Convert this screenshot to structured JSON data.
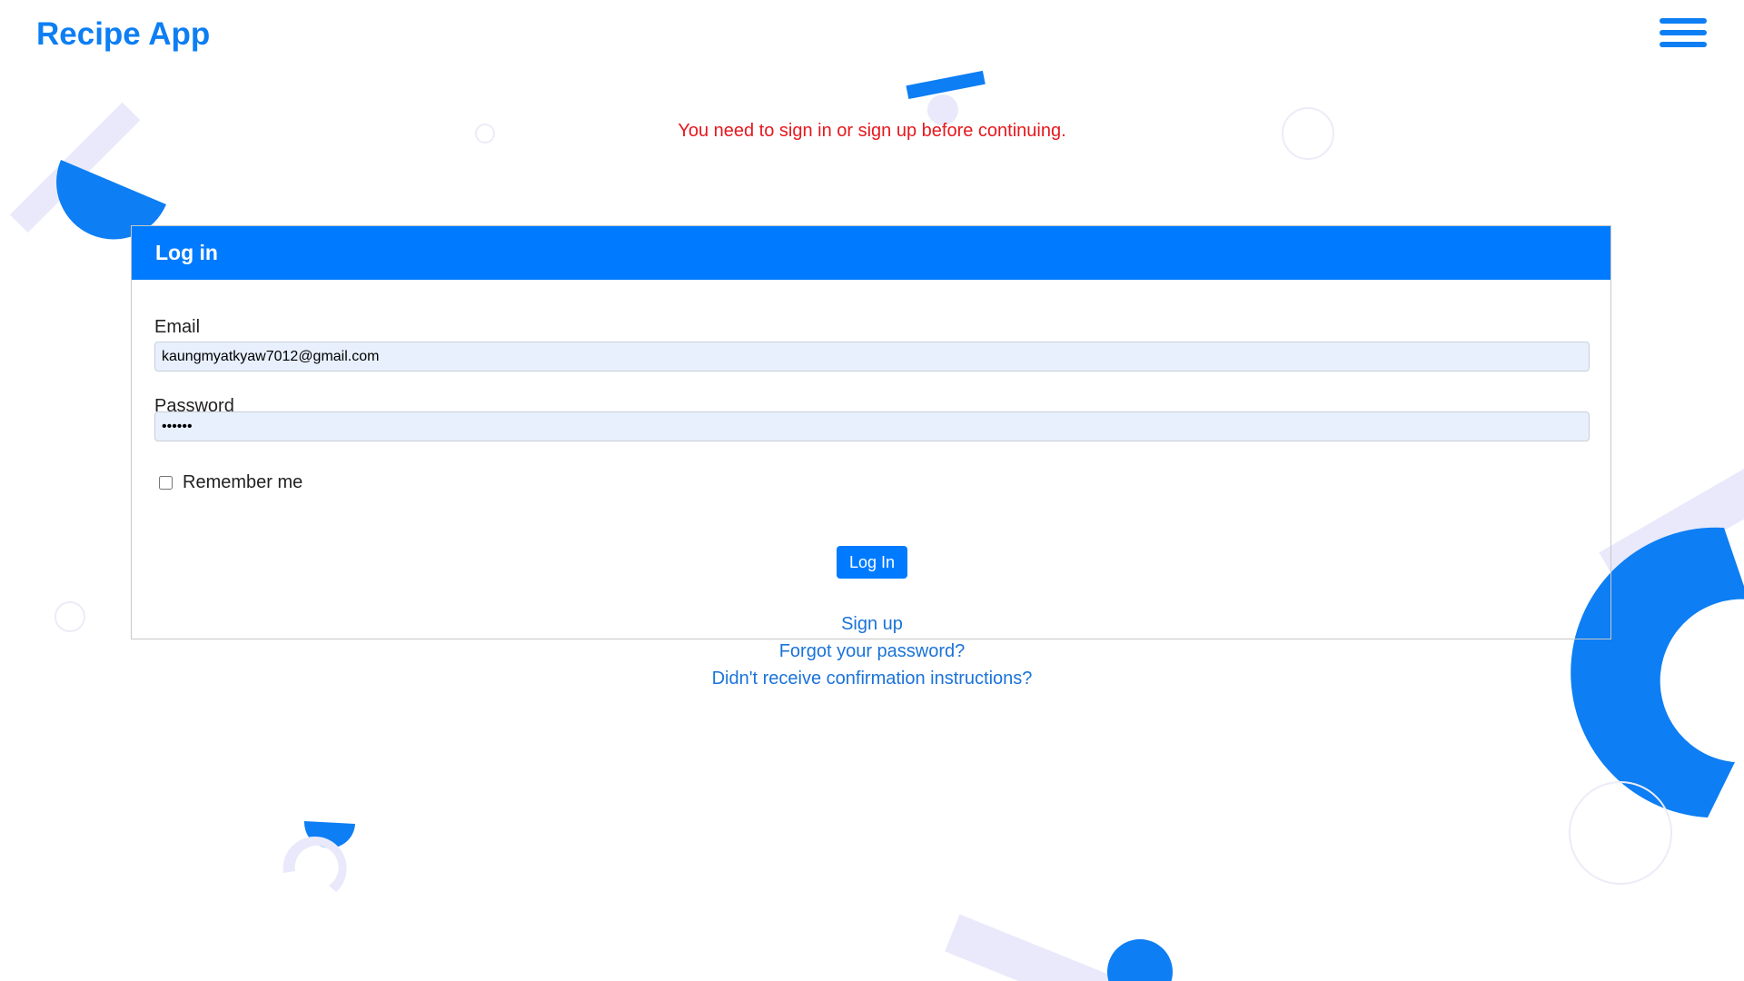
{
  "header": {
    "brand": "Recipe App",
    "menu_icon": "hamburger-menu-icon"
  },
  "flash": {
    "alert": "You need to sign in or sign up before continuing."
  },
  "login_form": {
    "title": "Log in",
    "email_label": "Email",
    "email_value": "kaungmyatkyaw7012@gmail.com",
    "password_label": "Password",
    "password_value": "••••••",
    "remember_label": "Remember me",
    "remember_checked": false,
    "submit_label": "Log In"
  },
  "links": {
    "sign_up": "Sign up",
    "forgot_password": "Forgot your password?",
    "confirmation": "Didn't receive confirmation instructions?"
  },
  "colors": {
    "primary": "#007bff",
    "brand": "#0d7ef3",
    "alert": "#e6181e",
    "decor_light": "#e9e9fb",
    "input_bg": "#e8f0fe"
  }
}
